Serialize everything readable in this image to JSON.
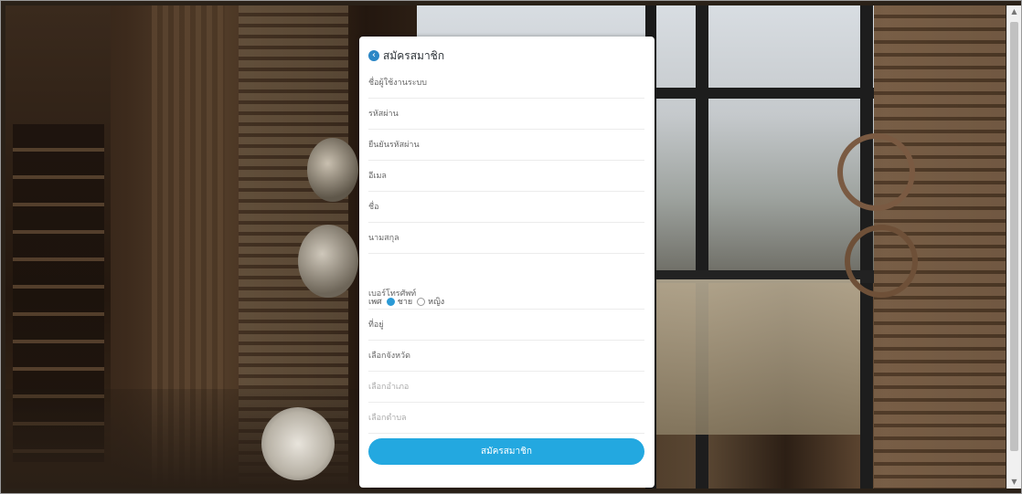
{
  "form": {
    "title": "สมัครสมาชิก",
    "fields": {
      "username": "ชื่อผู้ใช้งานระบบ",
      "password": "รหัสผ่าน",
      "confirm_password": "ยืนยันรหัสผ่าน",
      "email": "อีเมล",
      "first_name": "ชื่อ",
      "last_name": "นามสกุล",
      "phone": "เบอร์โทรศัพท์",
      "address": "ที่อยู่",
      "province": "เลือกจังหวัด",
      "district": "เลือกอำเภอ",
      "subdistrict": "เลือกตำบล"
    },
    "gender": {
      "label": "เพศ",
      "male": "ชาย",
      "female": "หญิง",
      "selected": "ชาย"
    },
    "submit_label": "สมัครสมาชิก"
  },
  "colors": {
    "accent": "#23a8e0",
    "icon": "#2b87c6"
  }
}
